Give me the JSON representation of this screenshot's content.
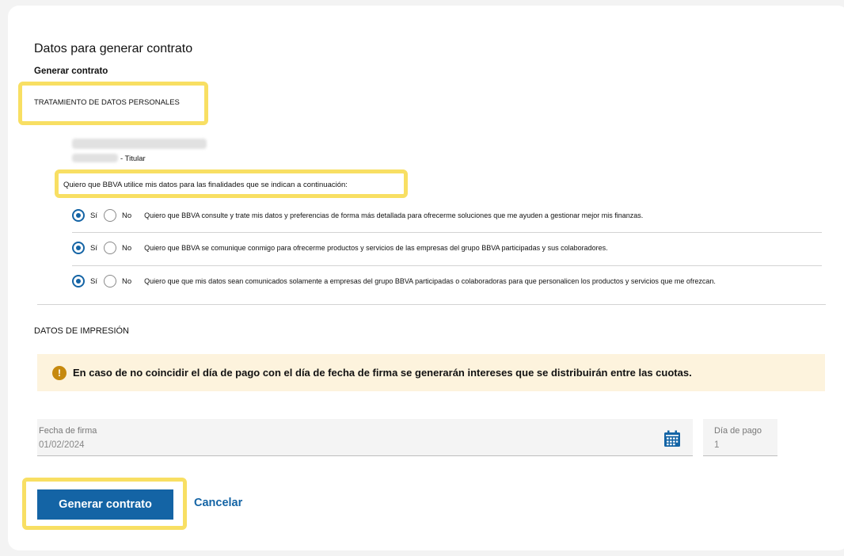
{
  "page": {
    "title": "Datos para generar contrato",
    "subtitle": "Generar contrato"
  },
  "personal_data": {
    "section_label": "TRATAMIENTO DE DATOS PERSONALES",
    "holder_role": "- Titular",
    "intro": "Quiero que BBVA utilice mis datos para las finalidades que se indican a continuación:",
    "options": [
      {
        "yes_label": "Sí",
        "no_label": "No",
        "selected": "Sí",
        "text": "Quiero que BBVA consulte y trate mis datos y preferencias de forma más detallada para ofrecerme soluciones que me ayuden a gestionar mejor mis finanzas."
      },
      {
        "yes_label": "Sí",
        "no_label": "No",
        "selected": "Sí",
        "text": "Quiero que BBVA se comunique conmigo para ofrecerme productos y servicios de las empresas del grupo BBVA participadas y sus colaboradores."
      },
      {
        "yes_label": "Sí",
        "no_label": "No",
        "selected": "Sí",
        "text": "Quiero que que mis datos sean comunicados solamente a empresas del grupo BBVA participadas o colaboradoras para que personalicen los productos y servicios que me ofrezcan."
      }
    ]
  },
  "print_data": {
    "section_label": "DATOS DE IMPRESIÓN",
    "alert_icon": "warning-icon",
    "alert_text": "En caso de no coincidir el día de pago con el día de fecha de firma se generarán intereses que se distribuirán entre las cuotas.",
    "signature_date": {
      "label": "Fecha de firma",
      "value": "01/02/2024",
      "icon": "calendar-icon"
    },
    "payment_day": {
      "label": "Día de pago",
      "value": "1"
    }
  },
  "actions": {
    "generate_label": "Generar contrato",
    "cancel_label": "Cancelar"
  },
  "colors": {
    "primary": "#1464a5",
    "highlight": "#f8df63",
    "alert_bg": "#fdf3dd",
    "alert_icon": "#c6890e"
  }
}
